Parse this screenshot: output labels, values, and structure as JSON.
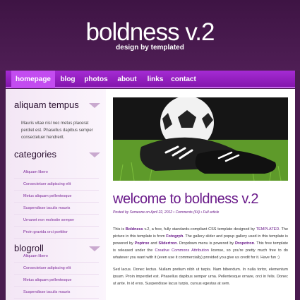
{
  "site": {
    "title": "boldness v.2",
    "tagline": "design by templated"
  },
  "nav": [
    "homepage",
    "blog",
    "photos",
    "about",
    "links",
    "contact"
  ],
  "sidebar": {
    "about_title": "aliquam tempus",
    "about_text": "Mauris vitae nisl nec metus placerat perdiet est. Phasellus dapibus semper consectetuer hendrerit.",
    "categories_title": "categories",
    "categories": [
      "Aliquam libero",
      "Consectetuer adipiscing elit",
      "Metus aliquam pellentesque",
      "Suspendisse iaculis mauris",
      "Urnanet non molestie semper",
      "Proin gravida orci porttitor"
    ],
    "blogroll_title": "blogroll",
    "blogroll": [
      "Aliquam libero",
      "Consectetuer adipiscing elit",
      "Metus aliquam pellentesque",
      "Suspendisse iaculis mauris"
    ]
  },
  "post": {
    "title": "welcome to boldness  v.2",
    "meta": "Posted by Someone on April 22, 2012  •  Comments (64)  •  Full article",
    "p1_a": "This is ",
    "p1_b": "Boldness",
    "p1_c": " v.2, a free, fully standards-compliant CSS template designed by ",
    "p1_d": "TEMPLATED",
    "p1_e": ". The picture in this template is from ",
    "p1_f": "Fotogrph",
    "p1_g": ". The gallery slider and popup gallery used in this template is powered by ",
    "p1_h": "Poptrox",
    "p1_i": " and ",
    "p1_j": "Slidertron",
    "p1_k": ". Dropdown menu is powered by ",
    "p1_l": "Dropotron",
    "p1_m": ". This free template is released under the ",
    "p1_n": "Creative Commons Attribution",
    "p1_o": " license, so you're pretty much free to do whatever you want with it (even use it commercially) provided you give us credit for it. Have fun :)",
    "p2": "Sed lacus. Donec lectus. Nullam pretium nibh ut turpis. Nam bibendum. In nulla tortor, elementum ipsum. Proin imperdiet est. Phasellus dapibus semper urna. Pellentesque ornare, orci in felis. Donec ut ante. In id eros. Suspendisse lacus turpis, cursus egestas at sem."
  },
  "colors": {
    "background": "#4a1c50",
    "nav": "#9a22c8",
    "nav_active": "#c34cf0",
    "accent": "#6a1b8a",
    "sidebar_bg": "#f3e6f5"
  }
}
